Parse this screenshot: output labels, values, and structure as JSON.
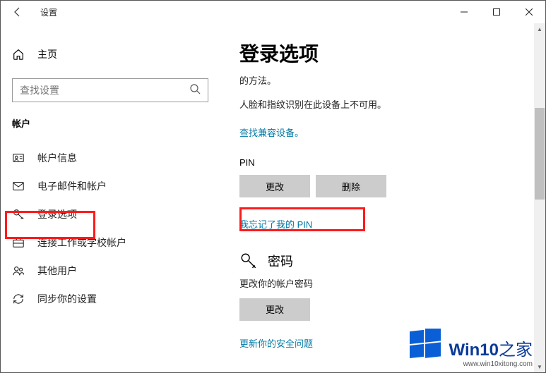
{
  "titlebar": {
    "title": "设置"
  },
  "sidebar": {
    "home_label": "主页",
    "search_placeholder": "查找设置",
    "section_label": "帐户",
    "items": [
      {
        "label": "帐户信息"
      },
      {
        "label": "电子邮件和帐户"
      },
      {
        "label": "登录选项"
      },
      {
        "label": "连接工作或学校帐户"
      },
      {
        "label": "其他用户"
      },
      {
        "label": "同步你的设置"
      }
    ]
  },
  "content": {
    "heading": "登录选项",
    "fragment": "的方法。",
    "biometric_msg": "人脸和指纹识别在此设备上不可用。",
    "compat_link": "查找兼容设备。",
    "pin_label": "PIN",
    "change_btn": "更改",
    "remove_btn": "删除",
    "forgot_pin": "我忘记了我的 PIN",
    "password_heading": "密码",
    "password_desc": "更改你的帐户密码",
    "password_change": "更改",
    "security_link": "更新你的安全问题"
  },
  "watermark": {
    "brand_en": "Win10",
    "brand_zh": "之家",
    "url": "www.win10xitong.com"
  },
  "colors": {
    "accent": "#0078a4",
    "highlight": "#ff1a1a"
  }
}
